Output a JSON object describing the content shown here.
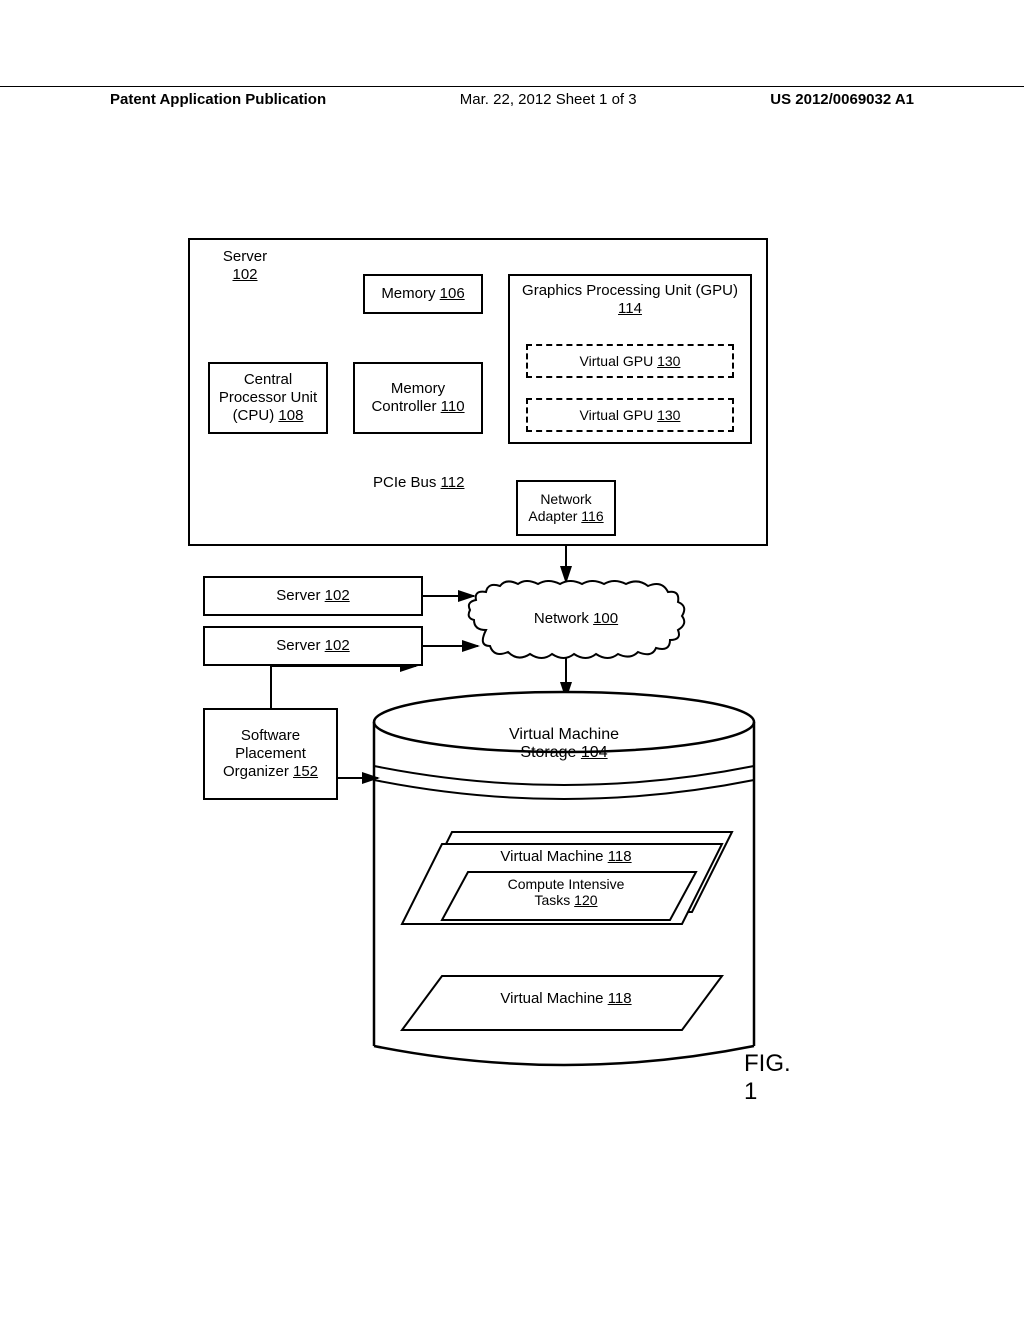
{
  "header": {
    "left": "Patent Application Publication",
    "mid": "Mar. 22, 2012  Sheet 1 of 3",
    "right": "US 2012/0069032 A1"
  },
  "server": {
    "title": "Server",
    "ref": "102",
    "memory": "Memory",
    "memory_ref": "106",
    "cpu_l1": "Central",
    "cpu_l2": "Processor Unit",
    "cpu_l3": "(CPU)",
    "cpu_ref": "108",
    "memctrl_l1": "Memory",
    "memctrl_l2": "Controller",
    "memctrl_ref": "110",
    "pcie": "PCIe Bus",
    "pcie_ref": "112",
    "gpu_title": "Graphics Processing Unit (GPU)",
    "gpu_ref": "114",
    "vgpu": "Virtual GPU",
    "vgpu_ref": "130",
    "net_l1": "Network",
    "net_l2": "Adapter",
    "net_ref": "116"
  },
  "servers_small": {
    "label": "Server",
    "ref": "102"
  },
  "spo": {
    "l1": "Software",
    "l2": "Placement",
    "l3": "Organizer",
    "ref": "152"
  },
  "network": {
    "label": "Network",
    "ref": "100"
  },
  "storage": {
    "title_l1": "Virtual Machine",
    "title_l2": "Storage",
    "ref": "104",
    "vm": "Virtual Machine",
    "vm_ref": "118",
    "compute_l1": "Compute Intensive",
    "compute_l2": "Tasks",
    "compute_ref": "120"
  },
  "fig": "FIG. 1"
}
